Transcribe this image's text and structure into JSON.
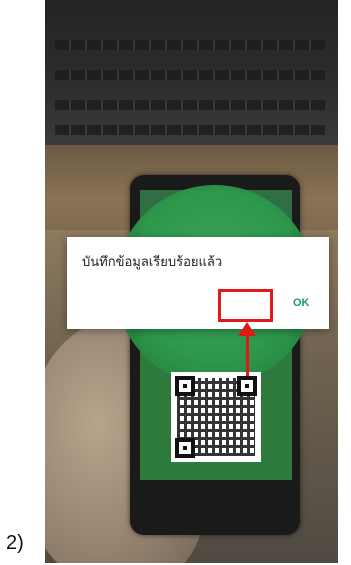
{
  "caption": "2)",
  "dialog": {
    "message": "บันทึกข้อมูลเรียบร้อยแล้ว",
    "ok_label": "OK"
  },
  "colors": {
    "screen_green": "#2e7a3c",
    "ok_text": "#1a9a7a",
    "annotation_red": "#e01818"
  },
  "icons": {
    "qr": "qr-code-icon",
    "annotation_arrow": "red-arrow-up-icon"
  }
}
